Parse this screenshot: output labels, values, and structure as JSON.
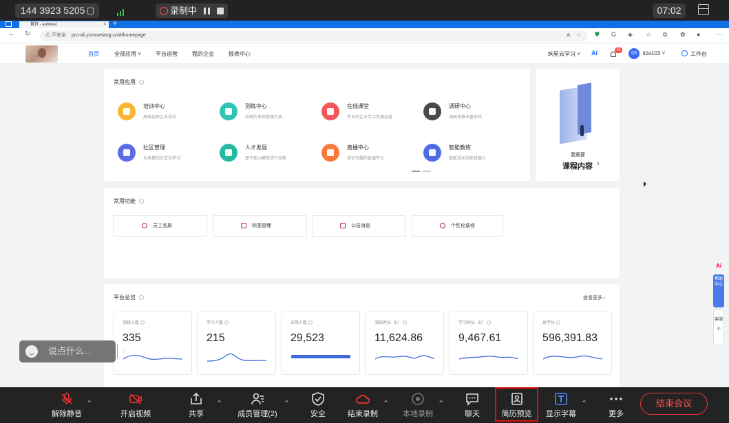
{
  "meeting_top": {
    "meeting_id": "144 3923 5205",
    "recording_label": "录制中",
    "time": "07:02"
  },
  "browser": {
    "tab_title": "首页 - autotest",
    "new_tab": "+",
    "security": "不安全",
    "url": "pro-ali.yunxuetang.cn/#/homepage"
  },
  "site": {
    "nav": [
      "首页",
      "全部应用",
      "平台运营",
      "我的企业",
      "报表中心"
    ],
    "nav_right": {
      "brand": "绚星云学习",
      "ai": "Ai",
      "badge": "99",
      "avatar": "03",
      "user": "liza103",
      "workspace": "工作台"
    },
    "common_apps_title": "常用应用",
    "apps": [
      {
        "name": "培训中心",
        "desc": "高效组织企业培训",
        "color": "#f7b733"
      },
      {
        "name": "测练中心",
        "desc": "系统的考核管理工具",
        "color": "#2ec4b6"
      },
      {
        "name": "在线课堂",
        "desc": "专业的企业学习资源运营",
        "color": "#f2575c"
      },
      {
        "name": "调研中心",
        "desc": "调研场景丰富多样",
        "color": "#4a4a4a"
      },
      {
        "name": "社区管理",
        "desc": "全场景的社交化学习",
        "color": "#5b6ee8"
      },
      {
        "name": "人才发展",
        "desc": "基于能力模型进行培养",
        "color": "#25b9a3"
      },
      {
        "name": "直播中心",
        "desc": "培训专属的直播平台",
        "color": "#f7793b"
      },
      {
        "name": "智能教练",
        "desc": "智能话术训练机器人",
        "color": "#4e6ce6"
      }
    ],
    "promo": {
      "line1": "我需要",
      "line2": "课程内容",
      "arrow": "›"
    },
    "common_func_title": "常用功能",
    "functions": [
      "员工名册",
      "标签管理",
      "公告消息",
      "个性化装修"
    ],
    "overview_title": "平台总览",
    "view_more": "查看更多",
    "stats": [
      {
        "label": "活跃人数",
        "value": "335"
      },
      {
        "label": "学习人数",
        "value": "215"
      },
      {
        "label": "应用人数",
        "value": "29,523"
      },
      {
        "label": "活跃时长（h）",
        "value": "11,624.86"
      },
      {
        "label": "学习时长（h）",
        "value": "9,467.61"
      },
      {
        "label": "总学分",
        "value": "596,391.83"
      }
    ],
    "side": {
      "ai": "Ai",
      "help": "帮助中心",
      "report": "客服"
    },
    "say_placeholder": "说点什么...",
    "say_collapse": "‹"
  },
  "toolbar": [
    {
      "label": "解除静音",
      "icon": "mic-muted-icon"
    },
    {
      "label": "开启视频",
      "icon": "video-off-icon"
    },
    {
      "label": "共享",
      "icon": "share-icon"
    },
    {
      "label": "成员管理(2)",
      "icon": "members-icon"
    },
    {
      "label": "安全",
      "icon": "shield-icon"
    },
    {
      "label": "结束录制",
      "icon": "cloud-record-icon"
    },
    {
      "label": "本地录制",
      "icon": "local-record-icon"
    },
    {
      "label": "聊天",
      "icon": "chat-icon"
    },
    {
      "label": "简历预览",
      "icon": "resume-icon"
    },
    {
      "label": "显示字幕",
      "icon": "caption-icon"
    },
    {
      "label": "更多",
      "icon": "more-icon"
    }
  ],
  "end_meeting": "结束会议"
}
